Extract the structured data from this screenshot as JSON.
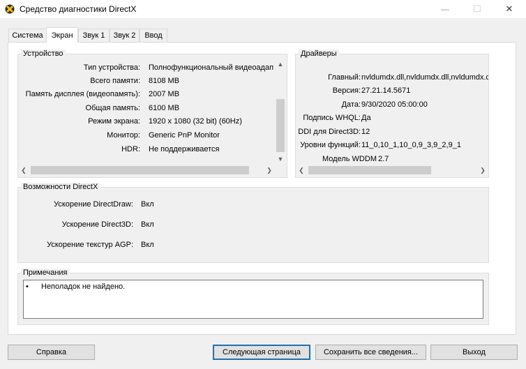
{
  "window": {
    "title": "Средство диагностики DirectX",
    "minimize_glyph": "—",
    "maximize_glyph": "☐",
    "close_glyph": "✕"
  },
  "tabs": [
    {
      "label": "Система",
      "active": false
    },
    {
      "label": "Экран",
      "active": true
    },
    {
      "label": "Звук 1",
      "active": false
    },
    {
      "label": "Звук 2",
      "active": false
    },
    {
      "label": "Ввод",
      "active": false
    }
  ],
  "device": {
    "title": "Устройство",
    "rows": [
      {
        "label": "Тип устройства:",
        "value": "Полнофункциональный видеоадап"
      },
      {
        "label": "Всего памяти:",
        "value": "8108 MB"
      },
      {
        "label": "Память дисплея (видеопамять):",
        "value": "2007 MB"
      },
      {
        "label": "Общая память:",
        "value": "6100 MB"
      },
      {
        "label": "Режим экрана:",
        "value": "1920 x 1080 (32 bit) (60Hz)"
      },
      {
        "label": "Монитор:",
        "value": "Generic PnP Monitor"
      },
      {
        "label": "HDR:",
        "value": "Не поддерживается"
      }
    ]
  },
  "drivers": {
    "title": "Драйверы",
    "rows": [
      {
        "label": "Главный:",
        "value": "nvldumdx.dll,nvldumdx.dll,nvldumdx.c"
      },
      {
        "label": "Версия:",
        "value": "27.21.14.5671"
      },
      {
        "label": "Дата:",
        "value": "9/30/2020 05:00:00"
      },
      {
        "label": "Подпись WHQL:",
        "value": "Да"
      },
      {
        "label": "DDI для Direct3D:",
        "value": "12"
      },
      {
        "label": "Уровни функций:",
        "value": "11_0,10_1,10_0,9_3,9_2,9_1"
      },
      {
        "label": "Модель WDDM",
        "value": "2.7"
      }
    ]
  },
  "directx": {
    "title": "Возможности DirectX",
    "rows": [
      {
        "label": "Ускорение DirectDraw:",
        "value": "Вкл"
      },
      {
        "label": "Ускорение Direct3D:",
        "value": "Вкл"
      },
      {
        "label": "Ускорение текстур AGP:",
        "value": "Вкл"
      }
    ]
  },
  "notes": {
    "title": "Примечания",
    "bullet": "•",
    "items": [
      "Неполадок не найдено."
    ]
  },
  "buttons": {
    "help": "Справка",
    "next": "Следующая страница",
    "save": "Сохранить все сведения...",
    "exit": "Выход"
  },
  "scroll_glyphs": {
    "up": "▲",
    "down": "▼",
    "left": "❮",
    "right": "❯"
  },
  "colors": {
    "accent": "#0078d7",
    "panel": "#ffffff",
    "background": "#f0f0f0"
  }
}
